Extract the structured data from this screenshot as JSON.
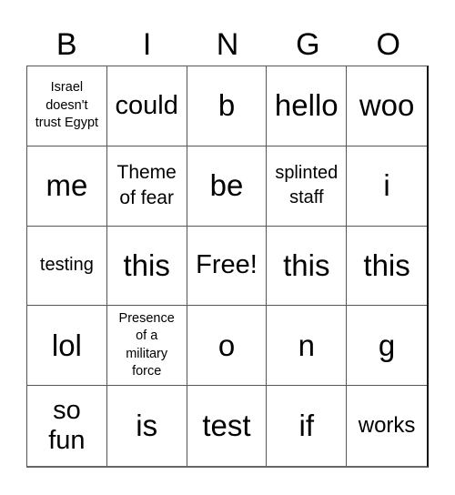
{
  "header": {
    "letters": [
      "B",
      "I",
      "N",
      "G",
      "O"
    ]
  },
  "board": {
    "cells": [
      [
        "Israel doesn't trust Egypt",
        "could",
        "b",
        "hello",
        "woo"
      ],
      [
        "me",
        "Theme of fear",
        "be",
        "splinted staff",
        "i"
      ],
      [
        "testing",
        "this",
        "Free!",
        "this",
        "this"
      ],
      [
        "lol",
        "Presence of a military force",
        "o",
        "n",
        "g"
      ],
      [
        "so fun",
        "is",
        "test",
        "if",
        "works"
      ]
    ]
  }
}
